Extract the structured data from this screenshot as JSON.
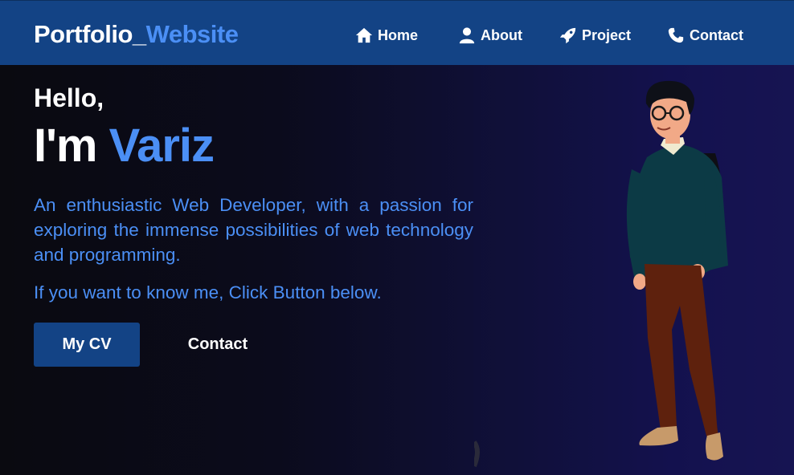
{
  "navbar": {
    "brand_main": "Portfolio_",
    "brand_accent": "Website",
    "items": [
      {
        "label": "Home",
        "icon": "home-icon"
      },
      {
        "label": "About",
        "icon": "user-icon"
      },
      {
        "label": "Project",
        "icon": "rocket-icon"
      },
      {
        "label": "Contact",
        "icon": "phone-icon"
      }
    ]
  },
  "hero": {
    "greeting": "Hello,",
    "im_prefix": "I'm ",
    "name": "Variz",
    "description": "An enthusiastic Web Developer, with a passion for exploring the immense possibilities of web technology and programming.",
    "cta_text": "If you want to know me, Click Button below.",
    "cv_button": "My CV",
    "contact_button": "Contact"
  },
  "colors": {
    "navbar_bg": "#134385",
    "accent": "#4b8ff5",
    "text": "#ffffff"
  }
}
